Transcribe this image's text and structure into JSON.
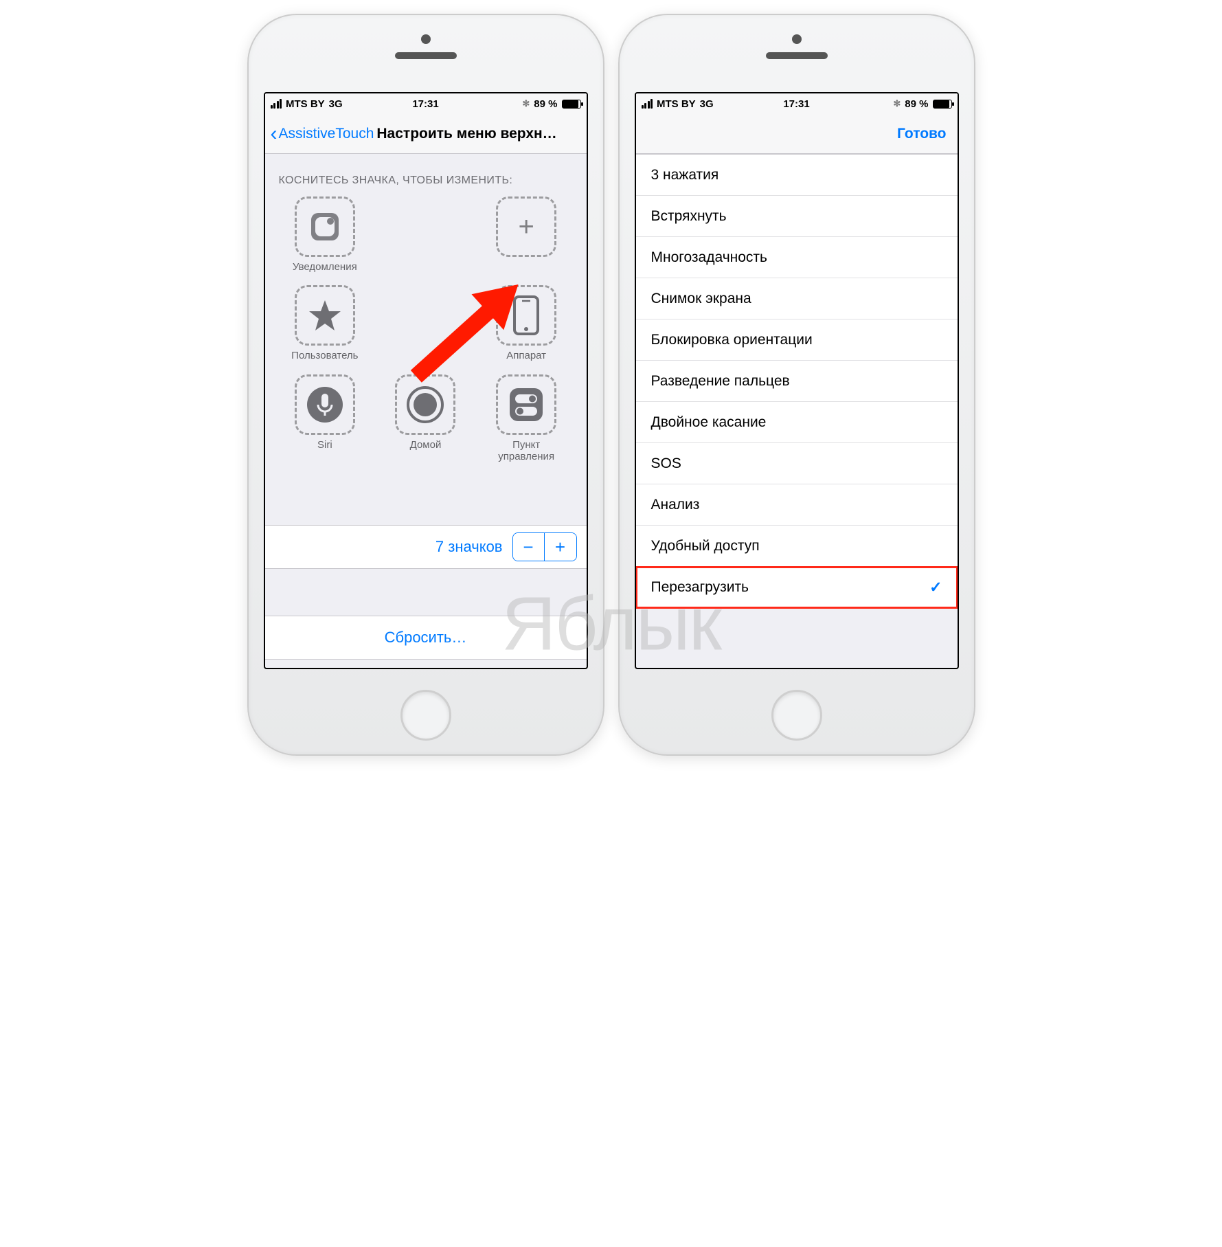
{
  "statusbar": {
    "carrier": "MTS BY",
    "network": "3G",
    "time": "17:31",
    "battery_pct": "89 %"
  },
  "left": {
    "back_label": "AssistiveTouch",
    "title": "Настроить меню верхн…",
    "section_header": "КОСНИТЕСЬ ЗНАЧКА, ЧТОБЫ ИЗМЕНИТЬ:",
    "icons": {
      "notifications": "Уведомления",
      "empty": "",
      "user": "Пользователь",
      "device": "Аппарат",
      "siri": "Siri",
      "home": "Домой",
      "control_center": "Пункт управления"
    },
    "count_label": "7 значков",
    "reset_label": "Сбросить…"
  },
  "right": {
    "done_label": "Готово",
    "items": [
      "3 нажатия",
      "Встряхнуть",
      "Многозадачность",
      "Снимок экрана",
      "Блокировка ориентации",
      "Разведение пальцев",
      "Двойное касание",
      "SOS",
      "Анализ",
      "Удобный доступ",
      "Перезагрузить"
    ],
    "selected_index": 10
  },
  "watermark": "Яблык"
}
